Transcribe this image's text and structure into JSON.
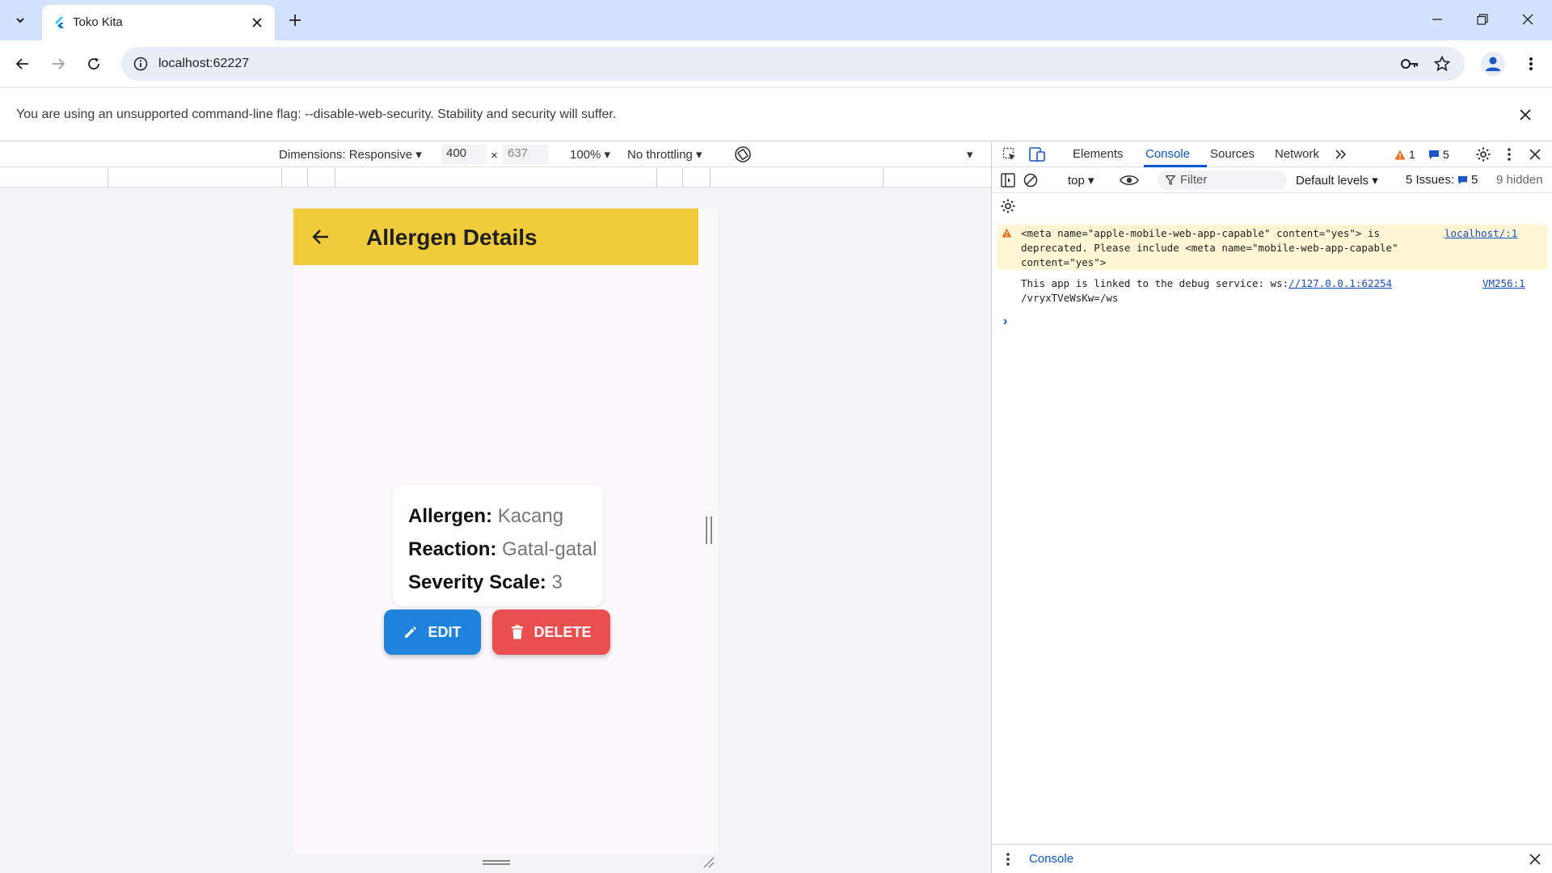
{
  "browser": {
    "tab_title": "Toko Kita",
    "url": "localhost:62227",
    "info_bar_text": "You are using an unsupported command-line flag: --disable-web-security. Stability and security will suffer."
  },
  "device_toolbar": {
    "dimensions_label": "Dimensions: Responsive",
    "width": "400",
    "times": "×",
    "height": "637",
    "zoom": "100%",
    "throttling": "No throttling"
  },
  "app": {
    "title": "Allergen Details",
    "card": {
      "rows": [
        {
          "label": "Allergen:",
          "value": "Kacang"
        },
        {
          "label": "Reaction:",
          "value": "Gatal-gatal"
        },
        {
          "label": "Severity Scale:",
          "value": "3"
        }
      ]
    },
    "edit_label": "EDIT",
    "delete_label": "DELETE",
    "colors": {
      "appbar": "#f0cc3c",
      "edit": "#1f83db",
      "delete": "#ea4f4f",
      "background": "#fdf7fe"
    }
  },
  "devtools": {
    "tabs": [
      "Elements",
      "Console",
      "Sources",
      "Network"
    ],
    "active_tab": "Console",
    "warning_count": "1",
    "message_count": "5",
    "context": "top",
    "filter_placeholder": "Filter",
    "levels": "Default levels",
    "issues_label": "5 Issues:",
    "issues_count": "5",
    "hidden_label": "9 hidden",
    "messages": {
      "warn_line1": "<meta name=\"apple-mobile-web-app-capable\" content=\"yes\"> is",
      "warn_line2": "deprecated. Please include <meta name=\"mobile-web-app-capable\"",
      "warn_line3": "content=\"yes\">",
      "warn_source": "localhost/:1",
      "log_prefix": "This app is linked to the debug service: ws:",
      "log_link": "//127.0.0.1:62254",
      "log_line2": "/vryxTVeWsKw=/ws",
      "log_source": "VM256:1",
      "prompt": "›"
    },
    "drawer_tab": "Console"
  }
}
